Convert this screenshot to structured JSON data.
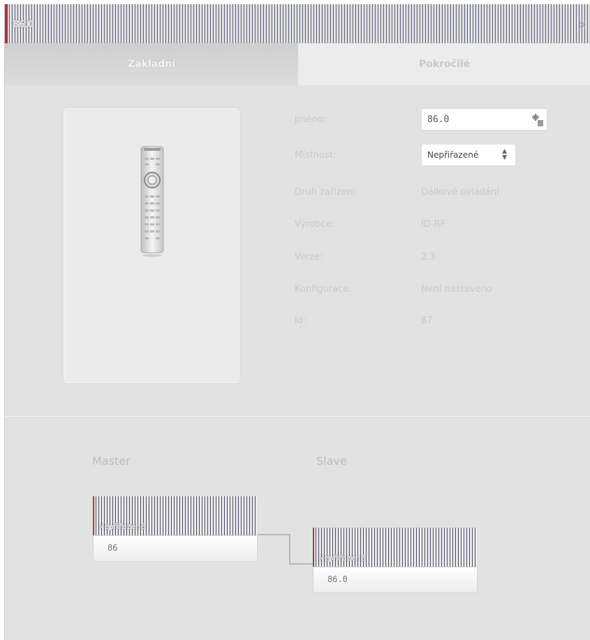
{
  "window": {
    "title": "86.0",
    "close_glyph": "✕"
  },
  "tabs": [
    {
      "label": "Základní",
      "active": true
    },
    {
      "label": "Pokročilé",
      "active": false
    }
  ],
  "device_image": {
    "icon": "remote-control-icon"
  },
  "form": {
    "name_label": "Jméno:",
    "name_value": "86.0",
    "room_label": "Místnost:",
    "room_value": "Nepřiřazené",
    "room_arrows": "▲▼"
  },
  "info": [
    {
      "label": "Druh zařízení:",
      "value": "Dálkové ovládání"
    },
    {
      "label": "Výrobce:",
      "value": "ID-RF"
    },
    {
      "label": "Verze:",
      "value": "2.3"
    },
    {
      "label": "Konfigurace:",
      "value": "Není nastaveno"
    },
    {
      "label": "Id:",
      "value": "87"
    }
  ],
  "relations": {
    "master_label": "Master",
    "slave_label": "Slave",
    "master_node": {
      "group": "Nepřiřazené",
      "value": "86"
    },
    "slave_node": {
      "group": "Nepřiřazené",
      "value": "86.0"
    }
  },
  "colors": {
    "background": "#e2e2e2",
    "accent": "#b0303a"
  }
}
